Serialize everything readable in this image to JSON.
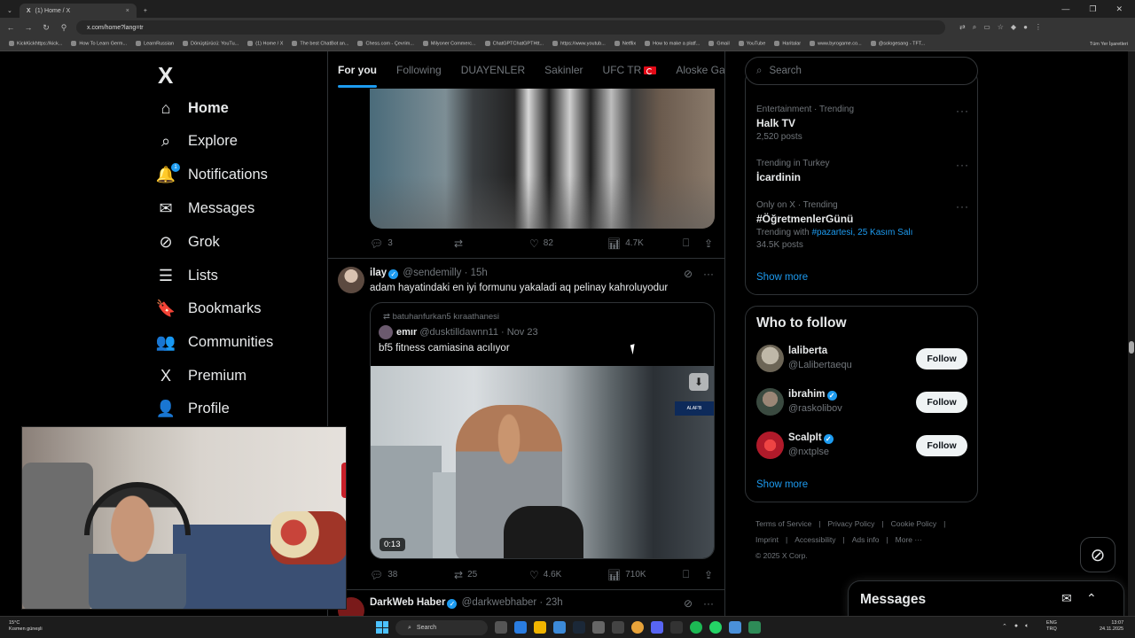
{
  "browser": {
    "tab_title": "(1) Home / X",
    "tab_close": "×",
    "new_tab": "+",
    "url": "x.com/home?lang=tr",
    "bookmarks": [
      "KickKickhttps://kick...",
      "How To Learn Germ...",
      "LearnRussian",
      "Dönüştürücü: YouTu...",
      "(1) Home / X",
      "The best ChatBot an...",
      "Chess.com - Çevrim...",
      "Milyoner Commerc...",
      "ChatGPTChatGPTHtt...",
      "https://www.youtub...",
      "Netflix",
      "How to make a platf...",
      "Gmail",
      "YouTube",
      "Haritalar",
      "www.byrogame.co...",
      "@sologesang - TFT..."
    ],
    "bookmarks_right": "Tüm Yer İşaretleri"
  },
  "sidebar": {
    "logo": "X",
    "badge": "1",
    "items": [
      {
        "label": "Home",
        "icon": "home-icon",
        "glyph": "⌂"
      },
      {
        "label": "Explore",
        "icon": "search-icon",
        "glyph": "⌕"
      },
      {
        "label": "Notifications",
        "icon": "bell-icon",
        "glyph": "🔔"
      },
      {
        "label": "Messages",
        "icon": "mail-icon",
        "glyph": "✉"
      },
      {
        "label": "Grok",
        "icon": "grok-icon",
        "glyph": "⊘"
      },
      {
        "label": "Lists",
        "icon": "list-icon",
        "glyph": "☰"
      },
      {
        "label": "Bookmarks",
        "icon": "bookmark-icon",
        "glyph": "🔖"
      },
      {
        "label": "Communities",
        "icon": "communities-icon",
        "glyph": "👥"
      },
      {
        "label": "Premium",
        "icon": "x-icon",
        "glyph": "X"
      },
      {
        "label": "Profile",
        "icon": "person-icon",
        "glyph": "👤"
      }
    ]
  },
  "timeline": {
    "tabs": [
      "For you",
      "Following",
      "DUAYENLER",
      "Sakinler",
      "UFC TR",
      "Aloske Gang"
    ],
    "post1_actions": {
      "replies": "3",
      "reposts": "",
      "likes": "82",
      "views": "4.7K"
    },
    "post2": {
      "name": "ilay",
      "handle": "@sendemilly",
      "time": "15h",
      "text": "adam hayatindaki en iyi formunu yakaladi aq pelinay kahroluyodur",
      "quote": {
        "reposted_by": "batuhanfurkan5 kıraathanesi",
        "name": "emır",
        "handle": "@dusktilldawnn11",
        "time": "Nov 23",
        "text": "bf5 fitness camiasina acılıyor",
        "video_time": "0:13",
        "badge": "ALAF'B"
      },
      "actions": {
        "replies": "38",
        "reposts": "25",
        "likes": "4.6K",
        "views": "710K"
      }
    },
    "post3": {
      "name": "DarkWeb Haber",
      "handle": "@darkwebhaber",
      "time": "23h"
    }
  },
  "right": {
    "search_placeholder": "Search",
    "trends": [
      {
        "meta": "Entertainment · Trending",
        "name": "Halk TV",
        "sub": "2,520 posts"
      },
      {
        "meta": "Trending in Turkey",
        "name": "İcardinin",
        "sub": ""
      },
      {
        "meta": "Only on X · Trending",
        "name": "#ÖğretmenlerGünü",
        "sub_prefix": "Trending with",
        "sub_links": "#pazartesi, 25 Kasım Salı",
        "sub2": "34.5K posts"
      }
    ],
    "show_more": "Show more",
    "who_title": "Who to follow",
    "who": [
      {
        "name": "laliberta",
        "handle": "@Lalibertaequ",
        "verified": false
      },
      {
        "name": "ibrahim",
        "handle": "@raskolibov",
        "verified": true
      },
      {
        "name": "ScalpIt",
        "handle": "@nxtplse",
        "verified": true
      }
    ],
    "follow_label": "Follow",
    "footer": [
      "Terms of Service",
      "Privacy Policy",
      "Cookie Policy",
      "Imprint",
      "Accessibility",
      "Ads info",
      "More ···",
      "© 2025 X Corp."
    ]
  },
  "messages_drawer": {
    "title": "Messages"
  },
  "taskbar": {
    "weather_temp": "15°C",
    "weather_desc": "Kısmen güneşli",
    "search": "Search",
    "lang": "ENG",
    "region": "TRQ",
    "time": "13:07",
    "date": "24.11.2025"
  }
}
